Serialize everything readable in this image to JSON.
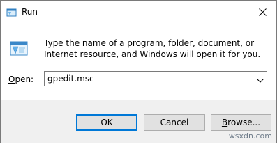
{
  "window": {
    "title": "Run",
    "description": "Type the name of a program, folder, document, or Internet resource, and Windows will open it for you."
  },
  "open": {
    "label_prefix": "",
    "label_accel": "O",
    "label_rest": "pen:",
    "value": "gpedit.msc"
  },
  "buttons": {
    "ok": "OK",
    "cancel": "Cancel",
    "browse_accel": "B",
    "browse_rest": "rowse..."
  },
  "watermark": "wsxdn.com",
  "colors": {
    "accent": "#0078d7",
    "footer_bg": "#f0f0f0",
    "button_bg": "#e1e1e1"
  },
  "icons": {
    "title": "run-app-icon",
    "large": "run-app-icon",
    "close": "close-icon",
    "dropdown": "chevron-down-icon"
  }
}
